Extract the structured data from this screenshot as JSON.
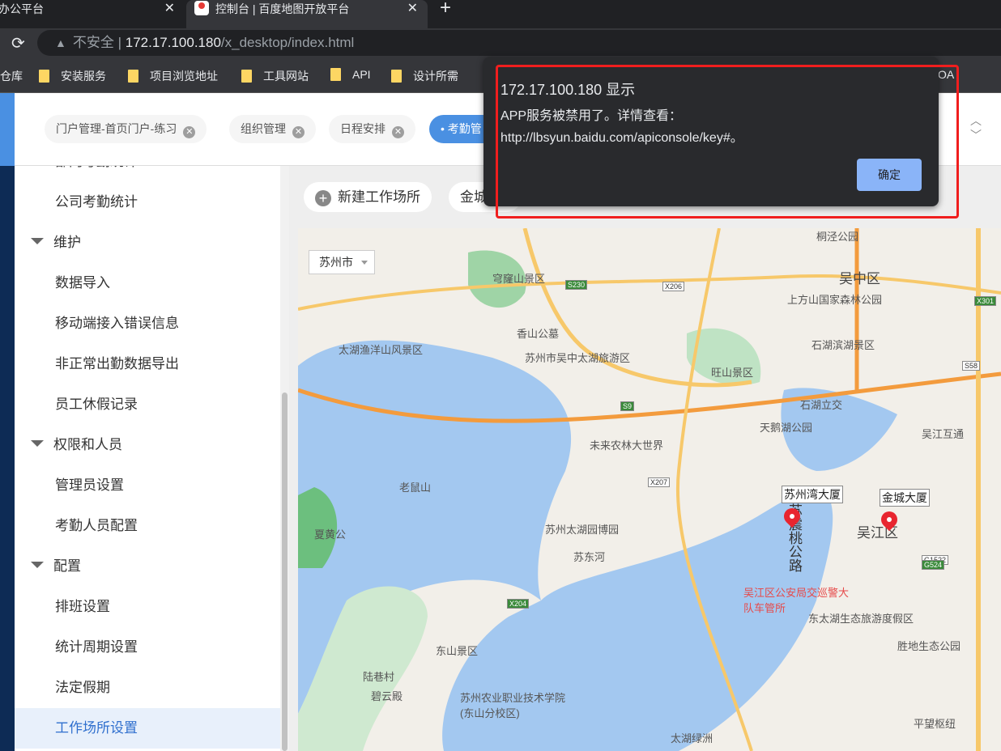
{
  "browser": {
    "tabs": [
      {
        "title": "办公平台",
        "close": "✕"
      },
      {
        "title": "控制台 | 百度地图开放平台",
        "close": "✕"
      }
    ],
    "new_tab": "+",
    "reload": "⟳",
    "security": "不安全",
    "url_host": "172.17.100.180",
    "url_path": "/x_desktop/index.html",
    "bookmarks": [
      "仓库",
      "安装服务",
      "项目浏览地址",
      "工具网站",
      "API",
      "设计所需",
      "OA"
    ]
  },
  "header": {
    "tags": [
      {
        "label": "门户管理-首页门户-练习"
      },
      {
        "label": "组织管理"
      },
      {
        "label": "日程安排"
      },
      {
        "label": "考勤管"
      }
    ],
    "close_glyph": "✕",
    "up": "︿",
    "down": "﹀"
  },
  "sidebar": {
    "items": [
      {
        "label": "部门考勤统计",
        "type": "item"
      },
      {
        "label": "公司考勤统计",
        "type": "item"
      },
      {
        "label": "维护",
        "type": "group"
      },
      {
        "label": "数据导入",
        "type": "item"
      },
      {
        "label": "移动端接入错误信息",
        "type": "item"
      },
      {
        "label": "非正常出勤数据导出",
        "type": "item"
      },
      {
        "label": "员工休假记录",
        "type": "item"
      },
      {
        "label": "权限和人员",
        "type": "group"
      },
      {
        "label": "管理员设置",
        "type": "item"
      },
      {
        "label": "考勤人员配置",
        "type": "item"
      },
      {
        "label": "配置",
        "type": "group"
      },
      {
        "label": "排班设置",
        "type": "item"
      },
      {
        "label": "统计周期设置",
        "type": "item"
      },
      {
        "label": "法定假期",
        "type": "item"
      },
      {
        "label": "工作场所设置",
        "type": "item",
        "selected": true
      }
    ]
  },
  "toolbar": {
    "new_workplace": "新建工作场所",
    "workplace_chip": "金城"
  },
  "map": {
    "city_select": "苏州市",
    "labels": [
      "吴中区",
      "穹窿山景区",
      "香山公墓",
      "太湖渔洋山风景区",
      "苏州市吴中太湖旅游区",
      "旺山景区",
      "上方山国家森林公园",
      "石湖滨湖景区",
      "石湖立交",
      "天鹅湖公园",
      "未来农林大世界",
      "吴江互通",
      "老鼠山",
      "苏州太湖园博园",
      "苏东河",
      "夏黄公",
      "东山景区",
      "陆巷村",
      "碧云殿",
      "苏州农业职业技术学院(东山分校区)",
      "吴江区公安局交巡警大队车管所",
      "东太湖生态旅游度假区",
      "胜地生态公园",
      "太湖绿洲",
      "平望枢纽",
      "苏震桃公路",
      "吴江区",
      "桐泾公园"
    ],
    "roads": [
      "S230",
      "X206",
      "X301",
      "S58",
      "S9",
      "X207",
      "X204",
      "G1522",
      "G524"
    ],
    "markers": [
      {
        "name": "苏州湾大厦"
      },
      {
        "name": "金城大厦"
      }
    ]
  },
  "dialog": {
    "title": "172.17.100.180 显示",
    "message": "APP服务被禁用了。详情查看：http://lbsyun.baidu.com/apiconsole/key#。",
    "ok": "确定"
  },
  "colors": {
    "accent": "#4a90e2",
    "dialog_bg": "#292a2d",
    "dialog_button": "#8ab4f8",
    "highlight": "#f01e1e",
    "water": "#a3c8f0",
    "park": "#bfe3c4"
  }
}
